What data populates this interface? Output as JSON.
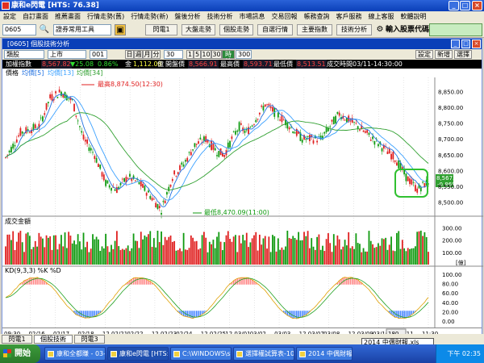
{
  "app": {
    "title": "康和e閃電 [HTS: 76.38]"
  },
  "menu": [
    "設定",
    "自訂畫面",
    "推薦畫面",
    "行情走勢(舊)",
    "行情走勢(新)",
    "盤後分析",
    "技術分析",
    "市場訊息",
    "交易回報",
    "帳務查詢",
    "客戶服務",
    "線上客服",
    "軟體說明"
  ],
  "toolbar": {
    "code_value": "0605",
    "search_icon": "search-icon",
    "common_tools": "證券常用工具",
    "btn_flash": "閃電1",
    "btn_big_trend": "大盤走勢",
    "btn_stock_trend": "個股走勢",
    "btn_custom_quote": "自選行情",
    "btn_main_index": "主要指數",
    "btn_tech": "技術分析",
    "input_label": "輸入股票代碼/名稱:"
  },
  "window": {
    "title": "[0605] 個股技術分析",
    "controls": {
      "category": "類股",
      "market": "上市",
      "code": "001",
      "periods": [
        "日",
        "週",
        "月",
        "分"
      ],
      "period_sel": "30",
      "mins": [
        "1",
        "5",
        "10",
        "30"
      ],
      "hour": "時線",
      "count": "300",
      "btn_settings": "設定",
      "btn_new": "新增",
      "btn_pick": "選擇"
    },
    "info": {
      "name": "加權指數",
      "last": "8,567.82",
      "change": "▼25.08",
      "pct": "0.86%",
      "amount_label": "金",
      "amount": "1,112.08",
      "unit": "億",
      "open_label": "開盤價",
      "open": "8,566.91",
      "high_label": "最高價",
      "high": "8,593.71",
      "low_label": "最低價",
      "low": "8,513.51",
      "time_label": "成交時間",
      "time": "03/11-14:30:00"
    },
    "legend": {
      "price": "價格",
      "ma5": "均價[5]",
      "ma13": "均價[13]",
      "ma34": "均價[34]"
    },
    "annotations": {
      "high": "最高8,874.50(12:30)",
      "low": "最低8,470.09(11:00)"
    },
    "price_label": "8,567.82",
    "price_change": "-0.86%",
    "volume_label": "成交金額",
    "volume_unit": "[億]",
    "kd_label": "KD(9,3,3) %K %D",
    "axis": {
      "price_ticks": [
        "8,850.00",
        "8,800.00",
        "8,750.00",
        "8,700.00",
        "8,650.00",
        "8,600.00",
        "8,550.00",
        "8,500.00"
      ],
      "vol_ticks": [
        "300.00",
        "200.00",
        "100.00"
      ],
      "kd_ticks": [
        "100.00",
        "80.00",
        "60.00",
        "40.00",
        "20.00",
        "0.00"
      ],
      "dates": [
        "09:30",
        "02/16",
        "02/17",
        "02/18",
        "12 02/21",
        "02/22",
        "12 02/23",
        "02/24",
        "12 02/25",
        "12 03/01",
        "03/02",
        "03/03",
        "12 03/07",
        "03/08",
        "12 03/09",
        "03/10",
        "03/11",
        "11:30"
      ],
      "zoom": "180"
    }
  },
  "bottom_tabs": [
    "閃電1",
    "個股技術",
    "閃電3"
  ],
  "taskbar": {
    "start": "開始",
    "tasks": [
      "康和全都賺 - 03-...",
      "康和e閃電 [HTS:...",
      "C:\\WINDOWS\\syst...",
      "選擇權試算表-10...",
      "2014 中偶財報.xls"
    ],
    "popup": "2014 中偶財報.xls",
    "clock": "下午 02:35"
  },
  "colors": {
    "up": "#e02020",
    "down": "#109a10",
    "ma5": "#2070e0",
    "ma13": "#3aa0ff",
    "ma34": "#30a030",
    "highlight": "#30c030"
  }
}
